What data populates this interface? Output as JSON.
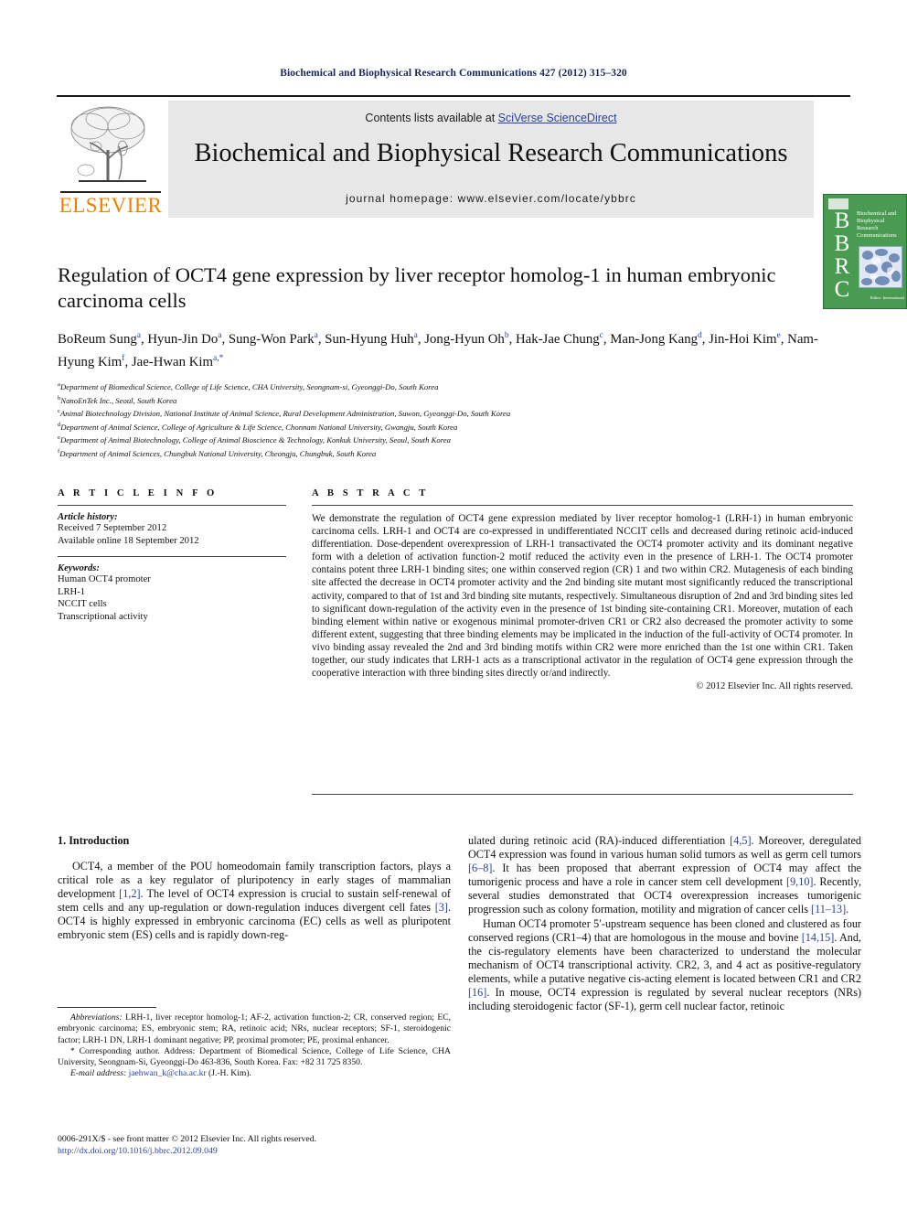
{
  "running_head": "Biochemical and Biophysical Research Communications 427 (2012) 315–320",
  "masthead": {
    "contents_prefix": "Contents lists available at ",
    "sciencedirect": "SciVerse ScienceDirect",
    "journal_title": "Biochemical and Biophysical Research Communications",
    "homepage": "journal homepage: www.elsevier.com/locate/ybbrc",
    "publisher_wordmark": "ELSEVIER",
    "cover": {
      "letters": "BBRC",
      "cover_title": "Biochemical and Biophysical Research Communications",
      "cover_footer": "Editor: International"
    },
    "accent_link_color": "#2a3f9d",
    "elsevier_orange": "#f08000",
    "cover_green": "#4a9b52",
    "band_gray": "#e7e7e7"
  },
  "article": {
    "title": "Regulation of OCT4 gene expression by liver receptor homolog-1 in human embryonic carcinoma cells",
    "authors_html": "BoReum Sung<sup>a</sup>, Hyun-Jin Do<sup>a</sup>, Sung-Won Park<sup>a</sup>, Sun-Hyung Huh<sup>a</sup>, Jong-Hyun Oh<sup>b</sup>, Hak-Jae Chung<sup>c</sup>, Man-Jong Kang<sup>d</sup>, Jin-Hoi Kim<sup>e</sup>, Nam-Hyung Kim<sup>f</sup>, Jae-Hwan Kim<sup>a,*</sup>",
    "affiliations": [
      {
        "marker": "a",
        "text": "Department of Biomedical Science, College of Life Science, CHA University, Seongnam-si, Gyeonggi-Do, South Korea"
      },
      {
        "marker": "b",
        "text": "NanoEnTek Inc., Seoul, South Korea"
      },
      {
        "marker": "c",
        "text": "Animal Biotechnology Division, National Institute of Animal Science, Rural Development Administration, Suwon, Gyeonggi-Do, South Korea"
      },
      {
        "marker": "d",
        "text": "Department of Animal Science, College of Agriculture & Life Science, Chonnam National University, Gwangju, South Korea"
      },
      {
        "marker": "e",
        "text": "Department of Animal Biotechnology, College of Animal Bioscience & Technology, Konkuk University, Seoul, South Korea"
      },
      {
        "marker": "f",
        "text": "Department of Animal Sciences, Chungbuk National University, Cheongju, Chungbuk, South Korea"
      }
    ]
  },
  "article_info": {
    "heading": "A R T I C L E    I N F O",
    "history_label": "Article history:",
    "history_lines": [
      "Received 7 September 2012",
      "Available online 18 September 2012"
    ],
    "keywords_label": "Keywords:",
    "keywords": [
      "Human OCT4 promoter",
      "LRH-1",
      "NCCIT cells",
      "Transcriptional activity"
    ]
  },
  "abstract": {
    "heading": "A B S T R A C T",
    "text": "We demonstrate the regulation of OCT4 gene expression mediated by liver receptor homolog-1 (LRH-1) in human embryonic carcinoma cells. LRH-1 and OCT4 are co-expressed in undifferentiated NCCIT cells and decreased during retinoic acid-induced differentiation. Dose-dependent overexpression of LRH-1 transactivated the OCT4 promoter activity and its dominant negative form with a deletion of activation function-2 motif reduced the activity even in the presence of LRH-1. The OCT4 promoter contains potent three LRH-1 binding sites; one within conserved region (CR) 1 and two within CR2. Mutagenesis of each binding site affected the decrease in OCT4 promoter activity and the 2nd binding site mutant most significantly reduced the transcriptional activity, compared to that of 1st and 3rd binding site mutants, respectively. Simultaneous disruption of 2nd and 3rd binding sites led to significant down-regulation of the activity even in the presence of 1st binding site-containing CR1. Moreover, mutation of each binding element within native or exogenous minimal promoter-driven CR1 or CR2 also decreased the promoter activity to some different extent, suggesting that three binding elements may be implicated in the induction of the full-activity of OCT4 promoter. In vivo binding assay revealed the 2nd and 3rd binding motifs within CR2 were more enriched than the 1st one within CR1. Taken together, our study indicates that LRH-1 acts as a transcriptional activator in the regulation of OCT4 gene expression through the cooperative interaction with three binding sites directly or/and indirectly.",
    "copyright": "© 2012 Elsevier Inc. All rights reserved."
  },
  "body": {
    "section_heading": "1. Introduction",
    "left_paragraph_html": "OCT4, a member of the POU homeodomain family transcription factors, plays a critical role as a key regulator of pluripotency in early stages of mammalian development <span class=\"ref\">[1,2]</span>. The level of OCT4 expression is crucial to sustain self-renewal of stem cells and any up-regulation or down-regulation induces divergent cell fates <span class=\"ref\">[3]</span>. OCT4 is highly expressed in embryonic carcinoma (EC) cells as well as pluripotent embryonic stem (ES) cells and is rapidly down-reg-",
    "right_paragraph1_html": "ulated during retinoic acid (RA)-induced differentiation <span class=\"ref\">[4,5]</span>. Moreover, deregulated OCT4 expression was found in various human solid tumors as well as germ cell tumors <span class=\"ref\">[6–8]</span>. It has been proposed that aberrant expression of OCT4 may affect the tumorigenic process and have a role in cancer stem cell development <span class=\"ref\">[9,10]</span>. Recently, several studies demonstrated that OCT4 overexpression increases tumorigenic progression such as colony formation, motility and migration of cancer cells <span class=\"ref\">[11–13]</span>.",
    "right_paragraph2_html": "Human OCT4 promoter 5′-upstream sequence has been cloned and clustered as four conserved regions (CR1–4) that are homologous in the mouse and bovine <span class=\"ref\">[14,15]</span>. And, the cis-regulatory elements have been characterized to understand the molecular mechanism of OCT4 transcriptional activity. CR2, 3, and 4 act as positive-regulatory elements, while a putative negative cis-acting element is located between CR1 and CR2 <span class=\"ref\">[16]</span>. In mouse, OCT4 expression is regulated by several nuclear receptors (NRs) including steroidogenic factor (SF-1), germ cell nuclear factor, retinoic"
  },
  "footnotes": {
    "abbreviations_html": "<span class=\"fn-italic\">Abbreviations:</span> LRH-1, liver receptor homolog-1; AF-2, activation function-2; CR, conserved region; EC, embryonic carcinoma; ES, embryonic stem; RA, retinoic acid; NRs, nuclear receptors; SF-1, steroidogenic factor; LRH-1 DN, LRH-1 dominant negative; PP, proximal promoter; PE, proximal enhancer.",
    "corresponding_html": "&#42; Corresponding author. Address: Department of Biomedical Science, College of Life Science, CHA University, Seongnam-Si, Gyeonggi-Do 463-836, South Korea. Fax: +82 31 725 8350.",
    "email_html": "<span class=\"fn-italic\">E-mail address:</span> <span class=\"link\">jaehwan_k@cha.ac.kr</span> (J.-H. Kim)."
  },
  "imprint": {
    "line1": "0006-291X/$ - see front matter © 2012 Elsevier Inc. All rights reserved.",
    "doi": "http://dx.doi.org/10.1016/j.bbrc.2012.09.049"
  }
}
